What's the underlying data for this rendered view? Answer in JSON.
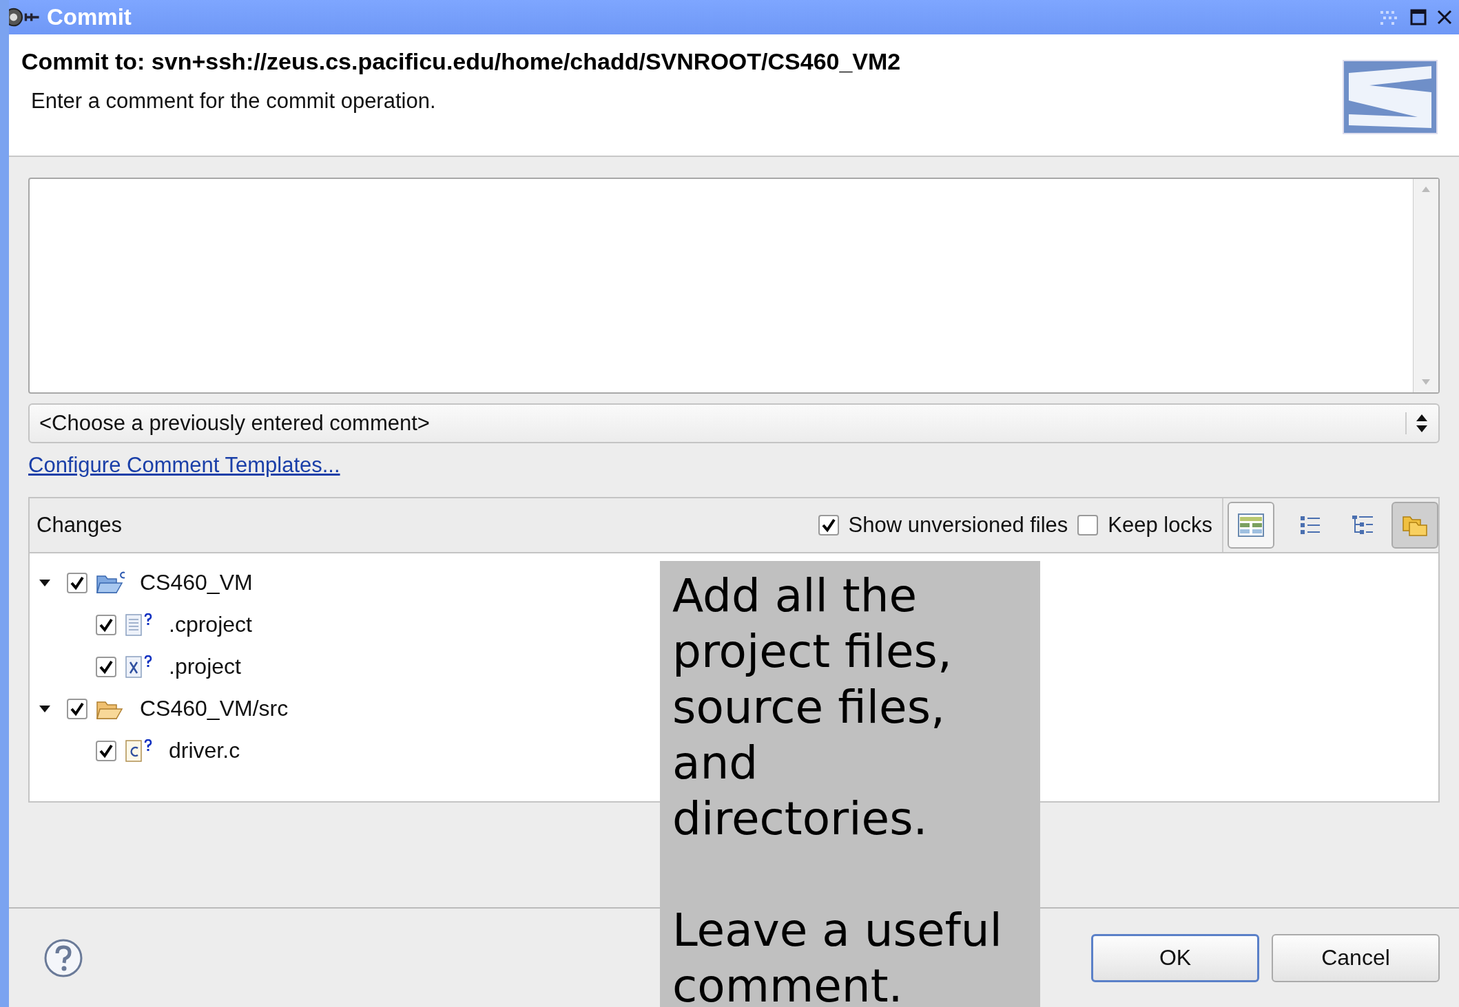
{
  "window": {
    "title": "Commit"
  },
  "header": {
    "title": "Commit to: svn+ssh://zeus.cs.pacificu.edu/home/chadd/SVNROOT/CS460_VM2",
    "description": "Enter a comment for the commit operation."
  },
  "previous_comments": {
    "value": "<Choose a previously entered comment>"
  },
  "templates_link": "Configure Comment Templates...",
  "changes": {
    "title": "Changes",
    "options": [
      {
        "label": "Show unversioned files",
        "checked": true
      },
      {
        "label": "Keep locks",
        "checked": false
      }
    ],
    "toolbar": [
      {
        "kind": "compare",
        "selected": true
      },
      {
        "kind": "flat",
        "selected": false
      },
      {
        "kind": "tree",
        "selected": false
      },
      {
        "kind": "compressed",
        "selected": true
      }
    ],
    "tree": [
      {
        "label": "CS460_VM",
        "kind": "project",
        "expanded": true,
        "checked": true,
        "children": [
          {
            "label": ".cproject",
            "kind": "text",
            "checked": true,
            "unversioned": true
          },
          {
            "label": ".project",
            "kind": "xml",
            "checked": true,
            "unversioned": true
          }
        ]
      },
      {
        "label": "CS460_VM/src",
        "kind": "folder",
        "expanded": true,
        "checked": true,
        "children": [
          {
            "label": "driver.c",
            "kind": "csource",
            "checked": true,
            "unversioned": true
          }
        ]
      }
    ]
  },
  "buttons": [
    "OK",
    "Cancel"
  ],
  "annotation": {
    "paragraphs": [
      "Add all the project files, source files, and directories.",
      "Leave a useful comment."
    ]
  }
}
